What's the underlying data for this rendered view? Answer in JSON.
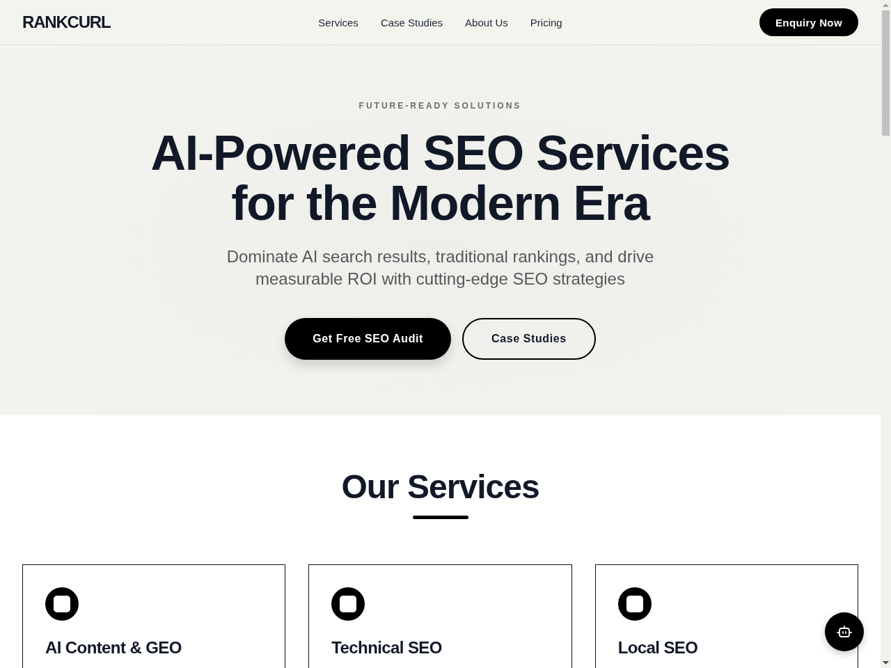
{
  "header": {
    "logo": "RANKCURL",
    "nav": [
      {
        "label": "Services"
      },
      {
        "label": "Case Studies"
      },
      {
        "label": "About Us"
      },
      {
        "label": "Pricing"
      }
    ],
    "cta": "Enquiry Now"
  },
  "hero": {
    "eyebrow": "FUTURE-READY SOLUTIONS",
    "title": "AI-Powered SEO Services for the Modern Era",
    "subtitle": "Dominate AI search results, traditional rankings, and drive measurable ROI with cutting-edge SEO strategies",
    "buttons": [
      {
        "label": "Get Free SEO Audit",
        "kind": "primary"
      },
      {
        "label": "Case Studies",
        "kind": "outline"
      }
    ]
  },
  "services": {
    "title": "Our Services",
    "cards": [
      {
        "title": "AI Content & GEO"
      },
      {
        "title": "Technical SEO"
      },
      {
        "title": "Local SEO"
      }
    ]
  }
}
